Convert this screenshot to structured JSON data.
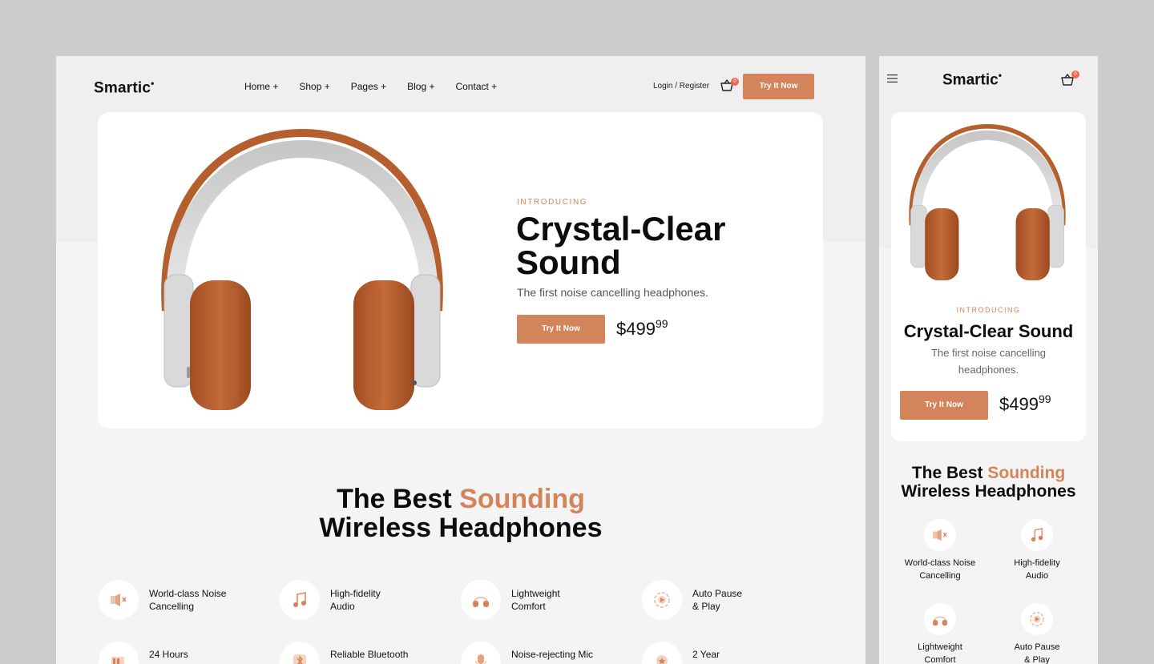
{
  "brand": {
    "name": "Smartic",
    "accent": "#d4845a",
    "badge_color": "#f06a4e"
  },
  "nav": {
    "items": [
      {
        "label": "Home +"
      },
      {
        "label": "Shop +"
      },
      {
        "label": "Pages +"
      },
      {
        "label": "Blog +"
      },
      {
        "label": "Contact +"
      }
    ],
    "login": "Login / Register",
    "cart_count": "0",
    "cta": "Try It Now"
  },
  "hero": {
    "eyebrow": "INTRODUCING",
    "title": "Crystal-Clear Sound",
    "subtitle": "The first noise cancelling headphones.",
    "cta": "Try It Now",
    "price_main": "$499",
    "price_cents": "99"
  },
  "section": {
    "title_part1": "The Best ",
    "title_accent": "Sounding",
    "title_part2": "Wireless Headphones"
  },
  "features": [
    {
      "icon": "speaker-mute-icon",
      "line1": "World-class Noise",
      "line2": "Cancelling"
    },
    {
      "icon": "music-note-icon",
      "line1": "High-fidelity",
      "line2": "Audio"
    },
    {
      "icon": "headphones-icon",
      "line1": "Lightweight",
      "line2": "Comfort"
    },
    {
      "icon": "play-circle-icon",
      "line1": "Auto Pause",
      "line2": "& Play"
    },
    {
      "icon": "battery-icon",
      "line1": "24 Hours",
      "line2": ""
    },
    {
      "icon": "bluetooth-icon",
      "line1": "Reliable Bluetooth",
      "line2": ""
    },
    {
      "icon": "microphone-icon",
      "line1": "Noise-rejecting Mic",
      "line2": ""
    },
    {
      "icon": "warranty-badge-icon",
      "line1": "2 Year",
      "line2": ""
    }
  ],
  "mobile": {
    "features": [
      {
        "line1": "World-class Noise",
        "line2": "Cancelling"
      },
      {
        "line1": "High-fidelity",
        "line2": "Audio"
      },
      {
        "line1": "Lightweight",
        "line2": "Comfort"
      },
      {
        "line1": "Auto Pause",
        "line2": "& Play"
      }
    ]
  }
}
